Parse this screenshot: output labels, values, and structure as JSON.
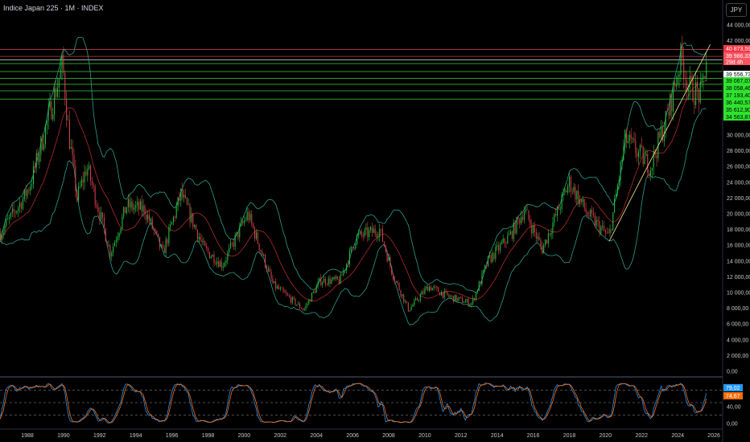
{
  "header": {
    "title": "Indice Japan 225 · 1M · INDEX",
    "currency": "JPY"
  },
  "price_axis": {
    "ticks": [
      "44 000,00",
      "42 000,00",
      "30 000,00",
      "28 000,00",
      "26 000,00",
      "24 000,00",
      "22 000,00",
      "20 000,00",
      "18 000,00",
      "16 000,00",
      "14 000,00",
      "12 000,00",
      "10 000,00",
      "8 000,00",
      "6 000,00",
      "4 000,00",
      "2 000,00",
      "0,00"
    ],
    "tick_values": [
      44000,
      42000,
      30000,
      28000,
      26000,
      24000,
      22000,
      20000,
      18000,
      16000,
      14000,
      12000,
      10000,
      8000,
      6000,
      4000,
      2000,
      0
    ]
  },
  "levels": [
    {
      "value": 40873.59,
      "label": "40 873,59",
      "color": "#f23645",
      "text": "#ffffff"
    },
    {
      "value": 39986.33,
      "label": "39 986,33",
      "sub": "29d 4h",
      "color": "#f7525f",
      "text": "#ffffff"
    },
    {
      "value": 39556.73,
      "label": "39 556,73",
      "color": "#ffffff",
      "text": "#000000"
    },
    {
      "value": 39067.07,
      "label": "39 067,07",
      "color": "#2ee32e",
      "text": "#000000"
    },
    {
      "value": 38058.46,
      "label": "38 058,46",
      "color": "#2ee32e",
      "text": "#000000"
    },
    {
      "value": 37193.4,
      "label": "37 193,40",
      "color": "#2ee32e",
      "text": "#000000"
    },
    {
      "value": 36440.57,
      "label": "36 440,57",
      "color": "#2ee32e",
      "text": "#000000"
    },
    {
      "value": 35612.9,
      "label": "35 612,90",
      "color": "#2ee32e",
      "text": "#000000"
    },
    {
      "value": 34563.87,
      "label": "34 563,87",
      "color": "#2ee32e",
      "text": "#000000"
    }
  ],
  "oscillator": {
    "k_label": "79,02",
    "d_label": "74,67",
    "k_color": "#2196f3",
    "d_color": "#ff6d00",
    "axis": [
      "40,00",
      "0,00"
    ],
    "axis_values": [
      40,
      0
    ],
    "bands": [
      80,
      50,
      20
    ]
  },
  "chart_data": {
    "type": "candlestick",
    "title": "Indice Japan 225 · 1M · INDEX",
    "x_ticks": [
      "1988",
      "1990",
      "1992",
      "1994",
      "1996",
      "1998",
      "2000",
      "2002",
      "2004",
      "2006",
      "2008",
      "2010",
      "2012",
      "2014",
      "2016",
      "2018",
      "2020",
      "2022",
      "2024",
      "2026"
    ],
    "x_range": [
      1986.5,
      2026.5
    ],
    "ylim": [
      0,
      47000
    ],
    "keyframes": [
      [
        1986.5,
        17500
      ],
      [
        1987.8,
        22000
      ],
      [
        1988.2,
        24000
      ],
      [
        1989.95,
        38900
      ],
      [
        1990.3,
        30000
      ],
      [
        1990.75,
        22000
      ],
      [
        1991.3,
        26000
      ],
      [
        1992.6,
        15000
      ],
      [
        1993.5,
        21000
      ],
      [
        1994.5,
        20500
      ],
      [
        1995.5,
        15000
      ],
      [
        1996.5,
        22500
      ],
      [
        1997.8,
        15500
      ],
      [
        1998.8,
        13500
      ],
      [
        2000.2,
        20000
      ],
      [
        2001.6,
        11000
      ],
      [
        2003.3,
        7800
      ],
      [
        2004.2,
        11500
      ],
      [
        2005.3,
        11500
      ],
      [
        2006.2,
        17000
      ],
      [
        2007.5,
        18000
      ],
      [
        2008.2,
        12500
      ],
      [
        2009.1,
        7800
      ],
      [
        2010.2,
        10800
      ],
      [
        2011.3,
        9500
      ],
      [
        2012.6,
        8600
      ],
      [
        2013.5,
        14000
      ],
      [
        2014.8,
        17500
      ],
      [
        2015.5,
        20500
      ],
      [
        2016.5,
        15500
      ],
      [
        2018.0,
        24000
      ],
      [
        2019.0,
        20000
      ],
      [
        2020.2,
        17000
      ],
      [
        2021.1,
        29500
      ],
      [
        2022.5,
        26000
      ],
      [
        2023.5,
        33000
      ],
      [
        2024.2,
        40000
      ],
      [
        2024.6,
        36000
      ],
      [
        2025.3,
        35000
      ],
      [
        2025.6,
        40000
      ]
    ],
    "trendline": [
      [
        2020.2,
        16500
      ],
      [
        2025.8,
        41500
      ]
    ],
    "indicators": [
      "Bollinger Bands (20,2)",
      "SMA 20",
      "Stochastic (14,3,3)"
    ]
  }
}
